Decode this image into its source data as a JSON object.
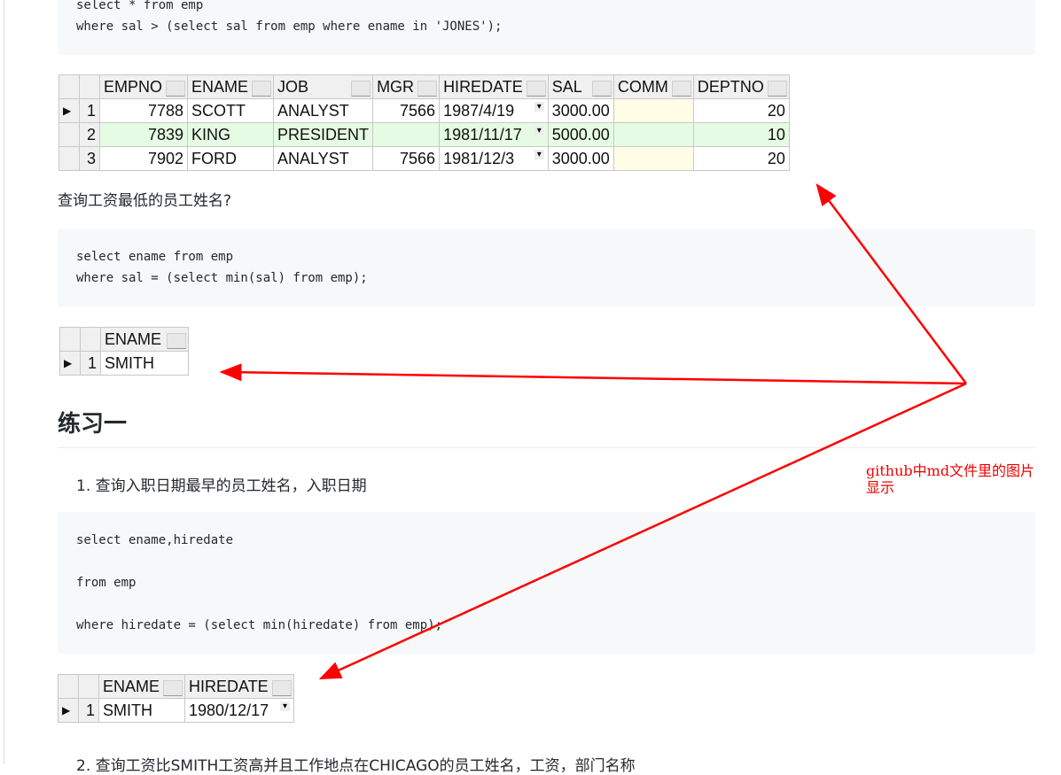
{
  "code1": [
    "select * from emp",
    "where sal > (select sal from emp where ename in 'JONES');"
  ],
  "table1": {
    "columns": [
      "EMPNO",
      "ENAME",
      "JOB",
      "MGR",
      "HIREDATE",
      "SAL",
      "COMM",
      "DEPTNO"
    ],
    "rows": [
      [
        "1",
        "7788",
        "SCOTT",
        "ANALYST",
        "7566",
        "1987/4/19",
        "3000.00",
        "",
        "20"
      ],
      [
        "2",
        "7839",
        "KING",
        "PRESIDENT",
        "",
        "1981/11/17",
        "5000.00",
        "",
        "10"
      ],
      [
        "3",
        "7902",
        "FORD",
        "ANALYST",
        "7566",
        "1981/12/3",
        "3000.00",
        "",
        "20"
      ]
    ]
  },
  "q2": "查询工资最低的员工姓名?",
  "code2": [
    "select ename from emp",
    "where sal = (select min(sal) from emp);"
  ],
  "table2": {
    "columns": [
      "ENAME"
    ],
    "rows": [
      [
        "1",
        "SMITH"
      ]
    ]
  },
  "heading": "练习一",
  "item1": "1. 查询入职日期最早的员工姓名，入职日期",
  "code3": [
    "select ename,hiredate",
    "",
    "from emp",
    "",
    "where hiredate = (select min(hiredate) from emp);"
  ],
  "table3": {
    "columns": [
      "ENAME",
      "HIREDATE"
    ],
    "rows": [
      [
        "1",
        "SMITH",
        "1980/12/17"
      ]
    ]
  },
  "item2": "2. 查询工资比SMITH工资高并且工作地点在CHICAGO的员工姓名，工资，部门名称",
  "annotation": "github中md文件里的图片显示",
  "colors": {
    "arrow": "#ff0000",
    "code_bg": "#f6f8fa",
    "selected_row": "#e6fbe3"
  }
}
